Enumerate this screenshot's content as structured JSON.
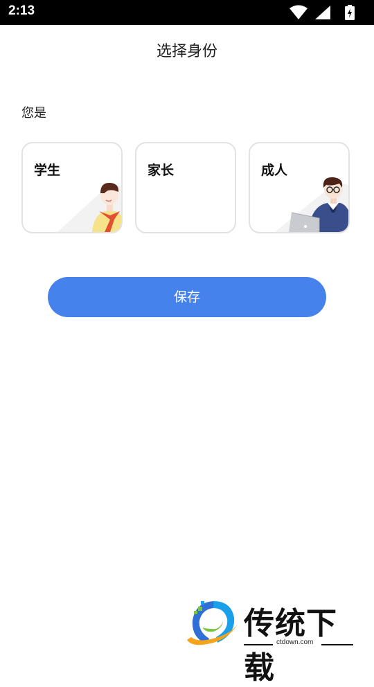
{
  "status_bar": {
    "time": "2:13"
  },
  "page": {
    "title": "选择身份",
    "prompt": "您是"
  },
  "cards": [
    {
      "label": "学生"
    },
    {
      "label": "家长"
    },
    {
      "label": "成人"
    }
  ],
  "actions": {
    "save_label": "保存"
  },
  "watermark": {
    "brand": "传统下载",
    "url": "ctdown.com"
  },
  "colors": {
    "accent": "#4682eb",
    "card_border": "#e2e2e2",
    "status_bar": "#000000"
  }
}
